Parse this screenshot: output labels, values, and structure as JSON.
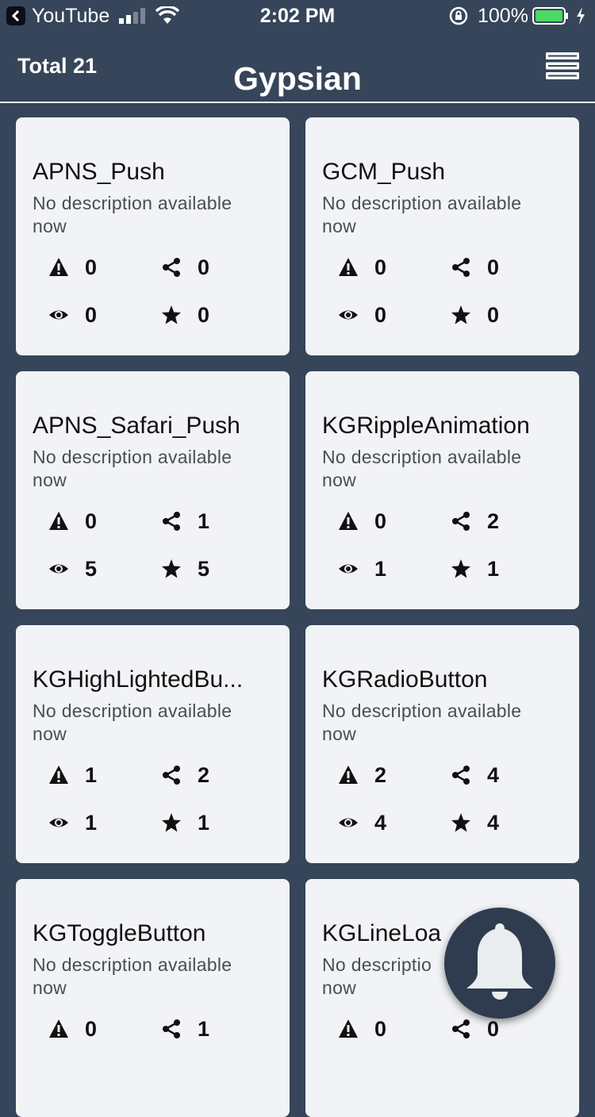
{
  "status_bar": {
    "back_app": "YouTube",
    "time": "2:02 PM",
    "battery_percent": "100%",
    "icons": [
      "back-icon",
      "signal-icon",
      "wifi-icon",
      "orientation-lock-icon",
      "battery-icon",
      "charging-icon"
    ]
  },
  "header": {
    "total": "Total 21",
    "title": "Gypsian",
    "menu_icon": "menu-icon"
  },
  "cards": [
    {
      "title": "APNS_Push",
      "description": "No description available now",
      "issues": "0",
      "forks": "0",
      "watchers": "0",
      "stars": "0"
    },
    {
      "title": "GCM_Push",
      "description": "No description available now",
      "issues": "0",
      "forks": "0",
      "watchers": "0",
      "stars": "0"
    },
    {
      "title": "APNS_Safari_Push",
      "description": "No description available now",
      "issues": "0",
      "forks": "1",
      "watchers": "5",
      "stars": "5"
    },
    {
      "title": "KGRippleAnimation",
      "description": "No description available now",
      "issues": "0",
      "forks": "2",
      "watchers": "1",
      "stars": "1"
    },
    {
      "title": "KGHighLightedBu...",
      "description": "No description available now",
      "issues": "1",
      "forks": "2",
      "watchers": "1",
      "stars": "1"
    },
    {
      "title": "KGRadioButton",
      "description": "No description available now",
      "issues": "2",
      "forks": "4",
      "watchers": "4",
      "stars": "4"
    },
    {
      "title": "KGToggleButton",
      "description": "No description available now",
      "issues": "0",
      "forks": "1",
      "watchers": "",
      "stars": ""
    },
    {
      "title": "KGLineLoa",
      "description": "No descriptio",
      "desc_line2": "now",
      "issues": "0",
      "forks": "0",
      "watchers": "",
      "stars": ""
    }
  ],
  "fab": {
    "icon": "bell-icon"
  },
  "colors": {
    "background": "#364559",
    "card": "#f2f3f6",
    "fab": "#2f3c4f",
    "battery": "#4cd964"
  }
}
